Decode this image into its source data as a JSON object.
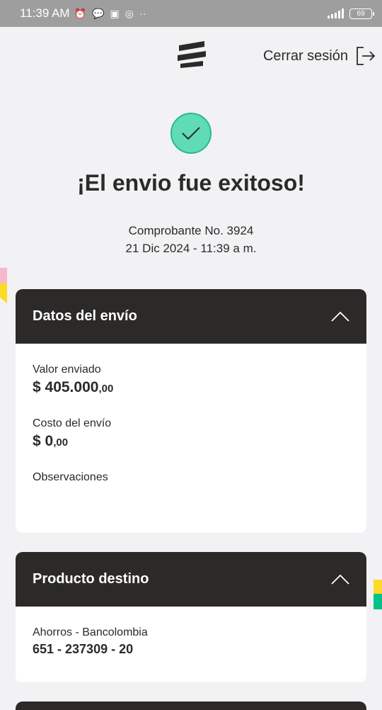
{
  "status_bar": {
    "time": "11:39 AM",
    "battery": "69"
  },
  "header": {
    "logout_label": "Cerrar sesión"
  },
  "success": {
    "title": "¡El envio fue exitoso!",
    "receipt_line": "Comprobante No. 3924",
    "datetime": "21 Dic 2024 - 11:39 a m."
  },
  "shipment": {
    "title": "Datos del envío",
    "sent_label": "Valor enviado",
    "sent_amount": "$ 405.000",
    "sent_cents": ",00",
    "cost_label": "Costo del envío",
    "cost_amount": "$ 0",
    "cost_cents": ",00",
    "notes_label": "Observaciones"
  },
  "destination": {
    "title": "Producto destino",
    "account_type": "Ahorros - Bancolombia",
    "account_number": "651 - 237309 - 20"
  },
  "colors": {
    "dark": "#2c2a29",
    "success_green": "#5fdcb3",
    "brand_yellow": "#fdda24",
    "brand_green": "#00c389",
    "brand_pink": "#f5b7cd"
  }
}
